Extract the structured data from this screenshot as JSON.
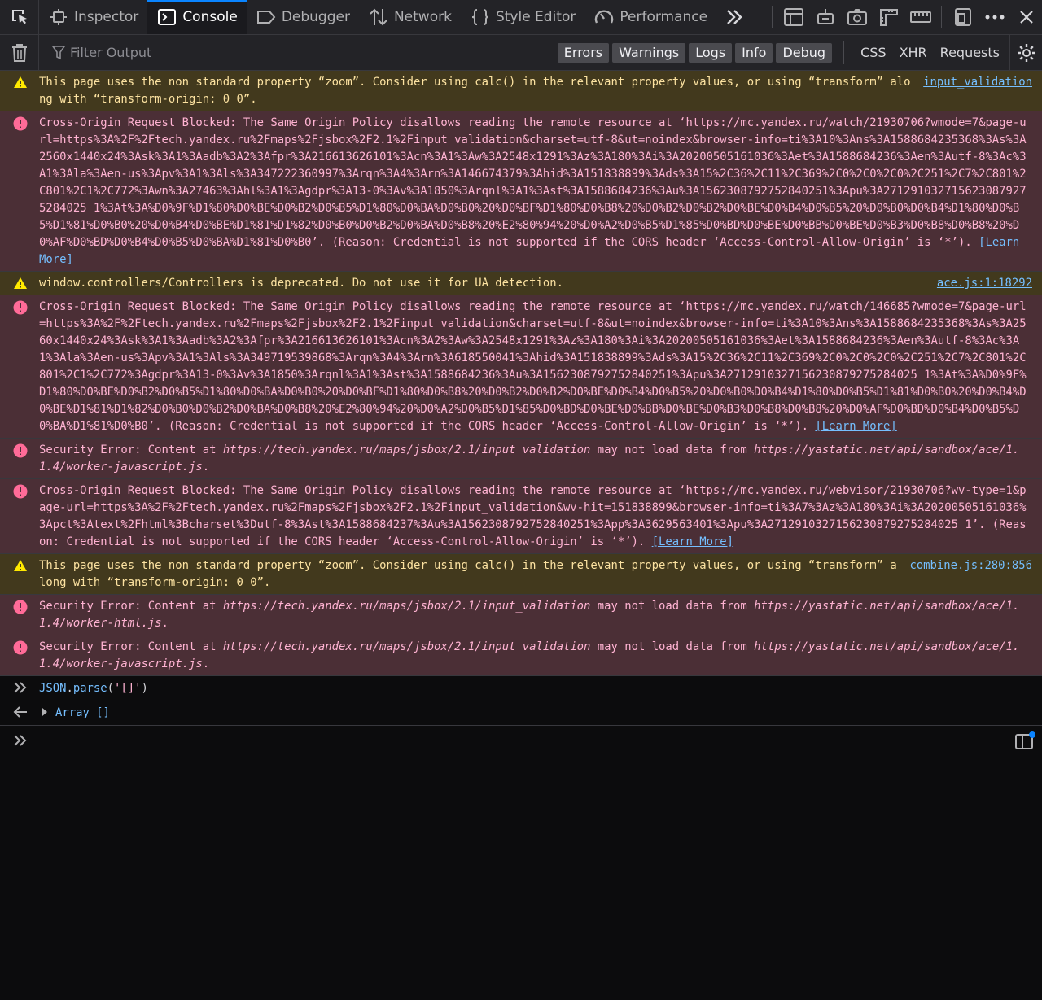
{
  "toolbar": {
    "tabs": [
      {
        "label": "Inspector",
        "icon": "inspector-icon"
      },
      {
        "label": "Console",
        "icon": "console-icon"
      },
      {
        "label": "Debugger",
        "icon": "debugger-icon"
      },
      {
        "label": "Network",
        "icon": "network-icon"
      },
      {
        "label": "Style Editor",
        "icon": "style-editor-icon"
      },
      {
        "label": "Performance",
        "icon": "performance-icon"
      }
    ],
    "active_tab": "Console",
    "accent": "#0a84ff"
  },
  "filterbar": {
    "placeholder": "Filter Output",
    "levels": [
      "Errors",
      "Warnings",
      "Logs",
      "Info",
      "Debug"
    ],
    "requests": [
      "CSS",
      "XHR",
      "Requests"
    ]
  },
  "messages": [
    {
      "type": "warning",
      "text": "This page uses the non standard property “zoom”. Consider using calc() in the relevant property values, or using “transform” along with “transform-origin: 0 0”.",
      "source": "input_validation"
    },
    {
      "type": "error",
      "text": "Cross-Origin Request Blocked: The Same Origin Policy disallows reading the remote resource at ‘https://mc.yandex.ru/watch/21930706?wmode=7&page-url=https%3A%2F%2Ftech.yandex.ru%2Fmaps%2Fjsbox%2F2.1%2Finput_validation&charset=utf-8&ut=noindex&browser-info=ti%3A10%3Ans%3A1588684235368%3As%3A2560x1440x24%3Ask%3A1%3Aadb%3A2%3Afpr%3A216613626101%3Acn%3A1%3Aw%3A2548x1291%3Az%3A180%3Ai%3A20200505161036%3Aet%3A1588684236%3Aen%3Autf-8%3Ac%3A1%3Ala%3Aen-us%3Apv%3A1%3Als%3A347222360997%3Arqn%3A4%3Arn%3A146674379%3Ahid%3A151838899%3Ads%3A15%2C36%2C11%2C369%2C0%2C0%2C0%2C251%2C7%2C801%2C801%2C1%2C772%3Awn%3A27463%3Ahl%3A1%3Agdpr%3A13-0%3Av%3A1850%3Arqnl%3A1%3Ast%3A1588684236%3Au%3A1562308792752840251%3Apu%3A2712910327156230879275284025 1%3At%3A%D0%9F%D1%80%D0%BE%D0%B2%D0%B5%D1%80%D0%BA%D0%B0%20%D0%BF%D1%80%D0%B8%20%D0%B2%D0%B2%D0%BE%D0%B4%D0%B5%20%D0%B0%D0%B4%D1%80%D0%B5%D1%81%D0%B0%20%D0%B4%D0%BE%D1%81%D1%82%D0%B0%D0%B2%D0%BA%D0%B8%20%E2%80%94%20%D0%A2%D0%B5%D1%85%D0%BD%D0%BE%D0%BB%D0%BE%D0%B3%D0%B8%D0%B8%20%D0%AF%D0%BD%D0%B4%D0%B5%D0%BA%D1%81%D0%B0’. (Reason: Credential is not supported if the CORS header ‘Access-Control-Allow-Origin’ is ‘*’).",
      "link": "[Learn More]"
    },
    {
      "type": "warning",
      "text": "window.controllers/Controllers is deprecated. Do not use it for UA detection.",
      "source": "ace.js:1:18292"
    },
    {
      "type": "error",
      "text": "Cross-Origin Request Blocked: The Same Origin Policy disallows reading the remote resource at ‘https://mc.yandex.ru/watch/146685?wmode=7&page-url=https%3A%2F%2Ftech.yandex.ru%2Fmaps%2Fjsbox%2F2.1%2Finput_validation&charset=utf-8&ut=noindex&browser-info=ti%3A10%3Ans%3A1588684235368%3As%3A2560x1440x24%3Ask%3A1%3Aadb%3A2%3Afpr%3A216613626101%3Acn%3A2%3Aw%3A2548x1291%3Az%3A180%3Ai%3A20200505161036%3Aet%3A1588684236%3Aen%3Autf-8%3Ac%3A1%3Ala%3Aen-us%3Apv%3A1%3Als%3A349719539868%3Arqn%3A4%3Arn%3A618550041%3Ahid%3A151838899%3Ads%3A15%2C36%2C11%2C369%2C0%2C0%2C0%2C251%2C7%2C801%2C801%2C1%2C772%3Agdpr%3A13-0%3Av%3A1850%3Arqnl%3A1%3Ast%3A1588684236%3Au%3A1562308792752840251%3Apu%3A2712910327156230879275284025 1%3At%3A%D0%9F%D1%80%D0%BE%D0%B2%D0%B5%D1%80%D0%BA%D0%B0%20%D0%BF%D1%80%D0%B8%20%D0%B2%D0%B2%D0%BE%D0%B4%D0%B5%20%D0%B0%D0%B4%D1%80%D0%B5%D1%81%D0%B0%20%D0%B4%D0%BE%D1%81%D1%82%D0%B0%D0%B2%D0%BA%D0%B8%20%E2%80%94%20%D0%A2%D0%B5%D1%85%D0%BD%D0%BE%D0%BB%D0%BE%D0%B3%D0%B8%D0%B8%20%D0%AF%D0%BD%D0%B4%D0%B5%D0%BA%D1%81%D0%B0’. (Reason: Credential is not supported if the CORS header ‘Access-Control-Allow-Origin’ is ‘*’).",
      "link": "[Learn More]"
    },
    {
      "type": "error",
      "pre": "Security Error: Content at ",
      "url1": "https://tech.yandex.ru/maps/jsbox/2.1/input_validation",
      "mid": " may not load data from ",
      "url2": "https://yastatic.net/api/sandbox/ace/1.1.4/worker-javascript.js",
      "post": "."
    },
    {
      "type": "error",
      "text": "Cross-Origin Request Blocked: The Same Origin Policy disallows reading the remote resource at ‘https://mc.yandex.ru/webvisor/21930706?wv-type=1&page-url=https%3A%2F%2Ftech.yandex.ru%2Fmaps%2Fjsbox%2F2.1%2Finput_validation&wv-hit=151838899&browser-info=ti%3A7%3Az%3A180%3Ai%3A20200505161036%3Apct%3Atext%2Fhtml%3Bcharset%3Dutf-8%3Ast%3A1588684237%3Au%3A1562308792752840251%3App%3A3629563401%3Apu%3A2712910327156230879275284025 1’. (Reason: Credential is not supported if the CORS header ‘Access-Control-Allow-Origin’ is ‘*’).",
      "link": "[Learn More]"
    },
    {
      "type": "warning",
      "text": "This page uses the non standard property “zoom”. Consider using calc() in the relevant property values, or using “transform” along with “transform-origin: 0 0”.",
      "source": "combine.js:280:856"
    },
    {
      "type": "error",
      "pre": "Security Error: Content at ",
      "url1": "https://tech.yandex.ru/maps/jsbox/2.1/input_validation",
      "mid": " may not load data from ",
      "url2": "https://yastatic.net/api/sandbox/ace/1.1.4/worker-html.js",
      "post": "."
    },
    {
      "type": "error",
      "pre": "Security Error: Content at ",
      "url1": "https://tech.yandex.ru/maps/jsbox/2.1/input_validation",
      "mid": " may not load data from ",
      "url2": "https://yastatic.net/api/sandbox/ace/1.1.4/worker-javascript.js",
      "post": "."
    }
  ],
  "command": {
    "obj": "JSON",
    "dot": ".",
    "fn": "parse",
    "open": "(",
    "arg": "'[]'",
    "close": ")"
  },
  "result": {
    "label": "Array []"
  }
}
